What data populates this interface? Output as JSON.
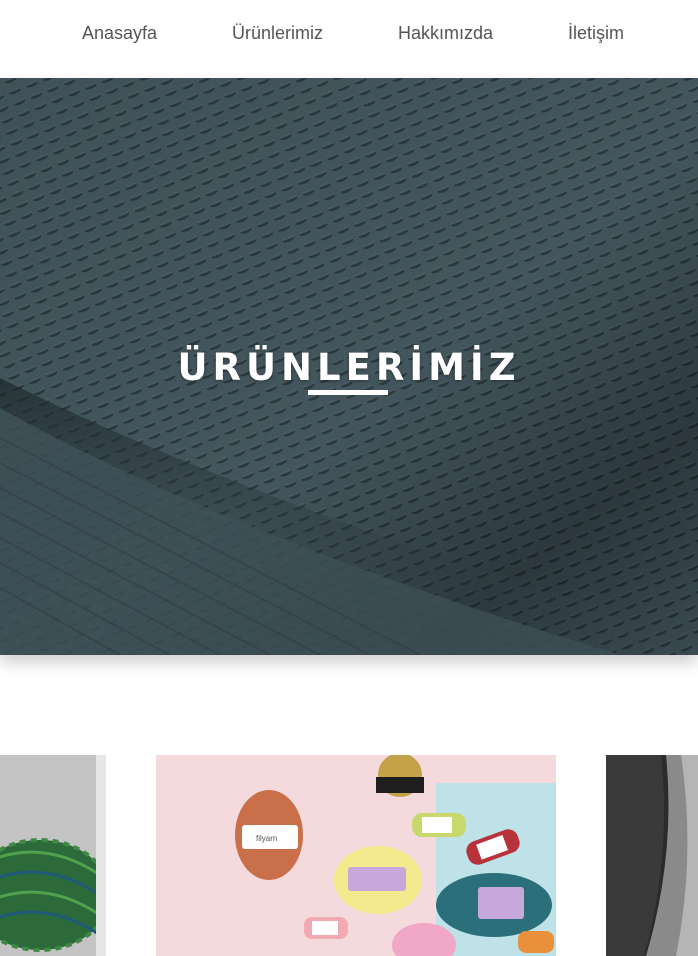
{
  "nav": {
    "items": [
      {
        "label": "Anasayfa"
      },
      {
        "label": "Ürünlerimiz"
      },
      {
        "label": "Hakkımızda"
      },
      {
        "label": "İletişim"
      }
    ]
  },
  "hero": {
    "title": "ÜRÜNLERİMİZ"
  },
  "products": {
    "images": [
      {
        "name": "green-yarn-cone-image"
      },
      {
        "name": "filyarn-yarn-balls-image"
      },
      {
        "name": "grey-fabric-image"
      }
    ],
    "brand_on_labels": "filyarn"
  },
  "colors": {
    "hero_fabric": "#3f5158",
    "nav_text": "#555555",
    "accent_white": "#ffffff"
  }
}
